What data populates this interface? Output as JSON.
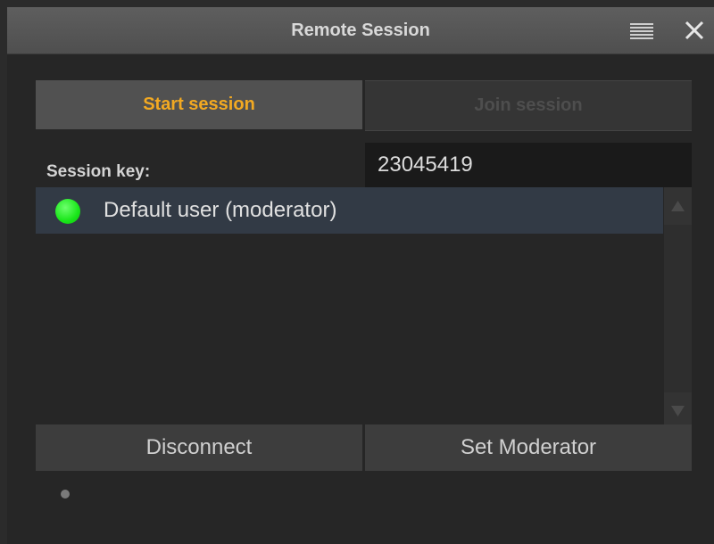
{
  "window": {
    "title": "Remote Session"
  },
  "tabs": [
    {
      "label": "Start session",
      "active": true
    },
    {
      "label": "Join session",
      "active": false
    }
  ],
  "session": {
    "key_label": "Session key:",
    "key_value": "23045419"
  },
  "users": [
    {
      "name": "Default user (moderator)",
      "status": "online",
      "status_color": "#19e619"
    }
  ],
  "buttons": {
    "disconnect": "Disconnect",
    "set_moderator": "Set Moderator"
  },
  "icons": {
    "menu": "hamburger-menu-icon",
    "close": "close-icon",
    "scroll_up": "triangle-up-icon",
    "scroll_down": "triangle-down-icon"
  },
  "colors": {
    "accent": "#f2a922",
    "selection": "#323a45",
    "online": "#19e619"
  }
}
